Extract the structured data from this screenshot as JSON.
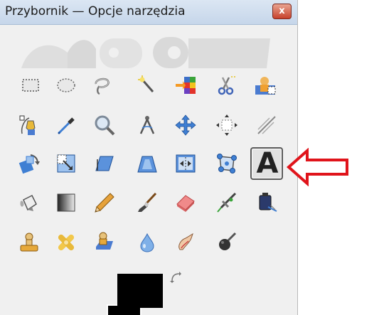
{
  "window": {
    "title": "Przybornik — Opcje narzędzia",
    "close_label": "x"
  },
  "tools": [
    {
      "name": "rect-select-tool-icon"
    },
    {
      "name": "ellipse-select-tool-icon"
    },
    {
      "name": "free-select-tool-icon"
    },
    {
      "name": "fuzzy-select-tool-icon"
    },
    {
      "name": "select-by-color-tool-icon"
    },
    {
      "name": "scissors-select-tool-icon"
    },
    {
      "name": "foreground-select-tool-icon"
    },
    {
      "name": "paths-tool-icon"
    },
    {
      "name": "color-picker-tool-icon"
    },
    {
      "name": "zoom-tool-icon"
    },
    {
      "name": "measure-tool-icon"
    },
    {
      "name": "move-tool-icon"
    },
    {
      "name": "align-tool-icon"
    },
    {
      "name": "crop-tool-icon"
    },
    {
      "name": "rotate-tool-icon"
    },
    {
      "name": "scale-tool-icon"
    },
    {
      "name": "shear-tool-icon"
    },
    {
      "name": "perspective-tool-icon"
    },
    {
      "name": "flip-tool-icon"
    },
    {
      "name": "cage-transform-tool-icon"
    },
    {
      "name": "text-tool-icon",
      "label": "A",
      "active": true
    },
    {
      "name": "bucket-fill-tool-icon"
    },
    {
      "name": "blend-tool-icon"
    },
    {
      "name": "pencil-tool-icon"
    },
    {
      "name": "paintbrush-tool-icon"
    },
    {
      "name": "eraser-tool-icon"
    },
    {
      "name": "airbrush-tool-icon"
    },
    {
      "name": "ink-tool-icon"
    },
    {
      "name": "clone-tool-icon"
    },
    {
      "name": "heal-tool-icon"
    },
    {
      "name": "perspective-clone-tool-icon"
    },
    {
      "name": "blur-sharpen-tool-icon"
    },
    {
      "name": "smudge-tool-icon"
    },
    {
      "name": "dodge-burn-tool-icon"
    }
  ],
  "colors": {
    "foreground": "#000000",
    "background": "#000000",
    "annotation_arrow": "#e0141b"
  }
}
